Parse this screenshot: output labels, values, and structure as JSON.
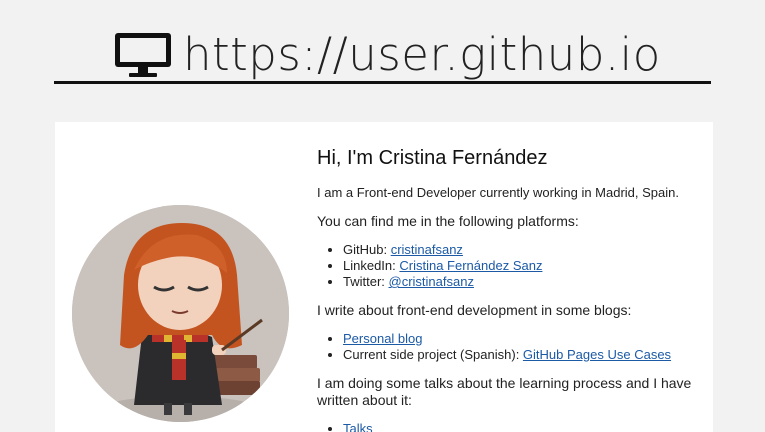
{
  "header": {
    "icon": "monitor-icon",
    "title": "https://user.github.io"
  },
  "page": {
    "heading": "Hi, I'm Cristina Fernández",
    "intro": "I am a Front-end Developer currently working in Madrid, Spain.",
    "platforms_text": "You can find me in the following platforms:",
    "platforms": [
      {
        "label": "GitHub: ",
        "link": "cristinafsanz"
      },
      {
        "label": "LinkedIn: ",
        "link": "Cristina Fernández Sanz"
      },
      {
        "label": "Twitter: ",
        "link": "@cristinafsanz"
      }
    ],
    "blogs_text": "I write about front-end development in some blogs:",
    "blogs": [
      {
        "label": "",
        "link": "Personal blog"
      },
      {
        "label": "Current side project (Spanish): ",
        "link": "GitHub Pages Use Cases"
      }
    ],
    "talks_text": "I am doing some talks about the learning process and I have written about it:",
    "talks": [
      {
        "label": "",
        "link": "Talks"
      }
    ]
  },
  "colors": {
    "link": "#1c5aa6",
    "background": "#f2f2f2",
    "card": "#ffffff"
  }
}
